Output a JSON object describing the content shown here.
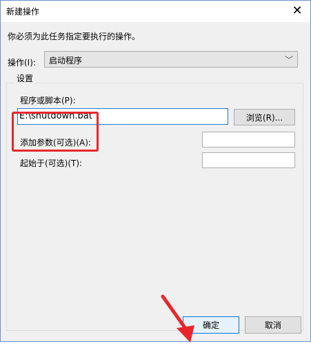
{
  "dialog": {
    "title": "新建操作",
    "instruction": "你必须为此任务指定要执行的操作。",
    "action_label": "操作(I):",
    "action_value": "启动程序",
    "settings_legend": "设置",
    "program_label": "程序或脚本(P):",
    "program_value": "E:\\shutdown.bat",
    "browse_label": "浏览(R)...",
    "args_label": "添加参数(可选)(A):",
    "args_value": "",
    "start_in_label": "起始于(可选)(T):",
    "start_in_value": "",
    "ok_label": "确定",
    "cancel_label": "取消"
  },
  "annotation_color": "#e8262b",
  "icons": {
    "close": "close-icon",
    "dropdown": "chevron-down-icon"
  }
}
